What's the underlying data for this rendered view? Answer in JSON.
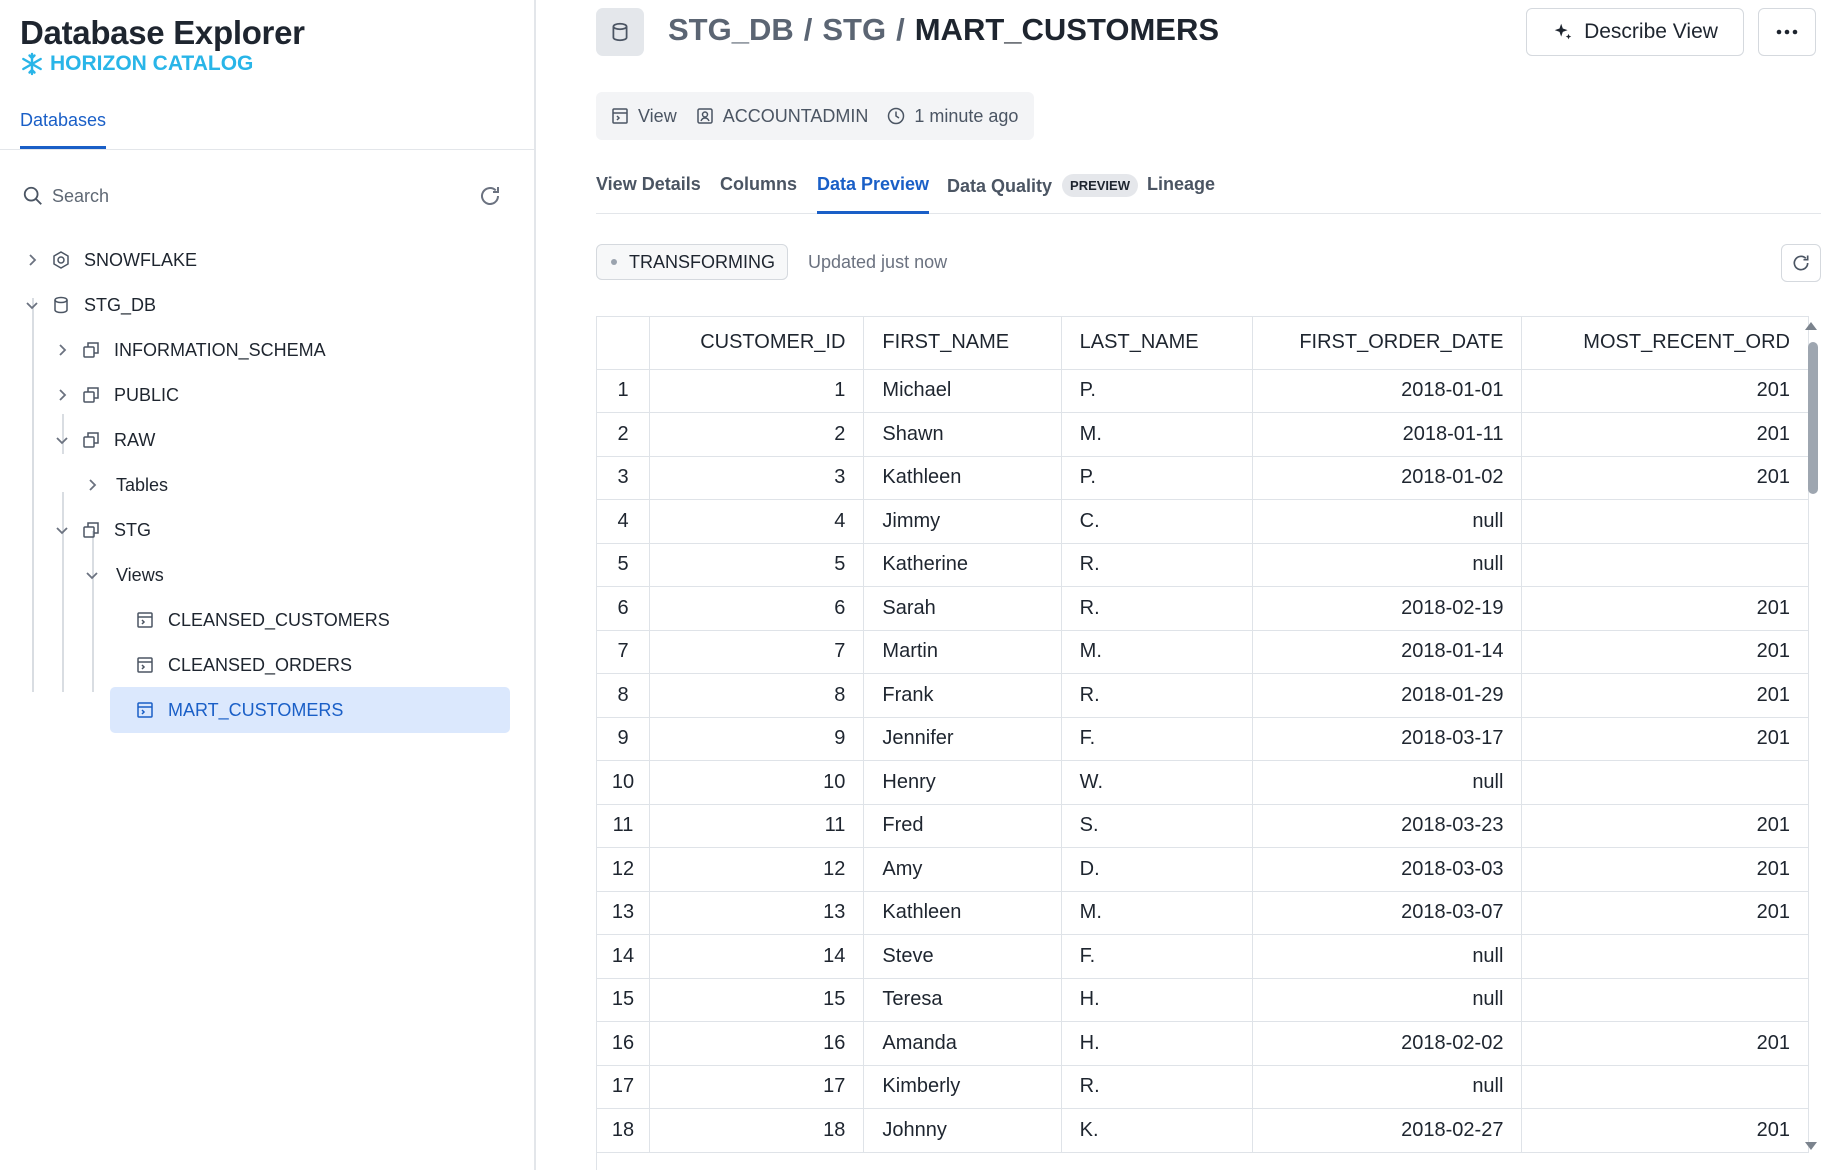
{
  "sidebar": {
    "app_title": "Database Explorer",
    "brand": "HORIZON CATALOG",
    "tab": "Databases",
    "search_placeholder": "Search",
    "tree": [
      {
        "label": "SNOWFLAKE",
        "icon": "database-share-icon",
        "expanded": false
      },
      {
        "label": "STG_DB",
        "icon": "database-icon",
        "expanded": true
      },
      {
        "label": "INFORMATION_SCHEMA",
        "icon": "schema-icon",
        "expanded": false
      },
      {
        "label": "PUBLIC",
        "icon": "schema-icon",
        "expanded": false
      },
      {
        "label": "RAW",
        "icon": "schema-icon",
        "expanded": true
      },
      {
        "label": "Tables",
        "icon": "",
        "expanded": false
      },
      {
        "label": "STG",
        "icon": "schema-icon",
        "expanded": true
      },
      {
        "label": "Views",
        "icon": "",
        "expanded": true
      },
      {
        "label": "CLEANSED_CUSTOMERS",
        "icon": "view-icon"
      },
      {
        "label": "CLEANSED_ORDERS",
        "icon": "view-icon"
      },
      {
        "label": "MART_CUSTOMERS",
        "icon": "view-icon",
        "selected": true
      }
    ]
  },
  "header": {
    "breadcrumb": [
      "STG_DB",
      "STG"
    ],
    "separator": "/",
    "current": "MART_CUSTOMERS",
    "describe_label": "Describe View"
  },
  "meta": {
    "type": "View",
    "owner": "ACCOUNTADMIN",
    "updated": "1 minute ago"
  },
  "tabs": [
    {
      "label": "View Details"
    },
    {
      "label": "Columns"
    },
    {
      "label": "Data Preview",
      "active": true
    },
    {
      "label": "Data Quality",
      "badge": "PREVIEW"
    },
    {
      "label": "Lineage"
    }
  ],
  "preview": {
    "status": "TRANSFORMING",
    "updated": "Updated just now"
  },
  "table": {
    "columns": [
      "CUSTOMER_ID",
      "FIRST_NAME",
      "LAST_NAME",
      "FIRST_ORDER_DATE",
      "MOST_RECENT_ORD"
    ],
    "rows": [
      [
        "1",
        "1",
        "Michael",
        "P.",
        "2018-01-01",
        "201"
      ],
      [
        "2",
        "2",
        "Shawn",
        "M.",
        "2018-01-11",
        "201"
      ],
      [
        "3",
        "3",
        "Kathleen",
        "P.",
        "2018-01-02",
        "201"
      ],
      [
        "4",
        "4",
        "Jimmy",
        "C.",
        "null",
        ""
      ],
      [
        "5",
        "5",
        "Katherine",
        "R.",
        "null",
        ""
      ],
      [
        "6",
        "6",
        "Sarah",
        "R.",
        "2018-02-19",
        "201"
      ],
      [
        "7",
        "7",
        "Martin",
        "M.",
        "2018-01-14",
        "201"
      ],
      [
        "8",
        "8",
        "Frank",
        "R.",
        "2018-01-29",
        "201"
      ],
      [
        "9",
        "9",
        "Jennifer",
        "F.",
        "2018-03-17",
        "201"
      ],
      [
        "10",
        "10",
        "Henry",
        "W.",
        "null",
        ""
      ],
      [
        "11",
        "11",
        "Fred",
        "S.",
        "2018-03-23",
        "201"
      ],
      [
        "12",
        "12",
        "Amy",
        "D.",
        "2018-03-03",
        "201"
      ],
      [
        "13",
        "13",
        "Kathleen",
        "M.",
        "2018-03-07",
        "201"
      ],
      [
        "14",
        "14",
        "Steve",
        "F.",
        "null",
        ""
      ],
      [
        "15",
        "15",
        "Teresa",
        "H.",
        "null",
        ""
      ],
      [
        "16",
        "16",
        "Amanda",
        "H.",
        "2018-02-02",
        "201"
      ],
      [
        "17",
        "17",
        "Kimberly",
        "R.",
        "null",
        ""
      ],
      [
        "18",
        "18",
        "Johnny",
        "K.",
        "2018-02-27",
        "201"
      ]
    ]
  },
  "colors": {
    "accent": "#1a5fc7",
    "brand": "#29b5e8",
    "selected_bg": "#dbe8fd"
  }
}
